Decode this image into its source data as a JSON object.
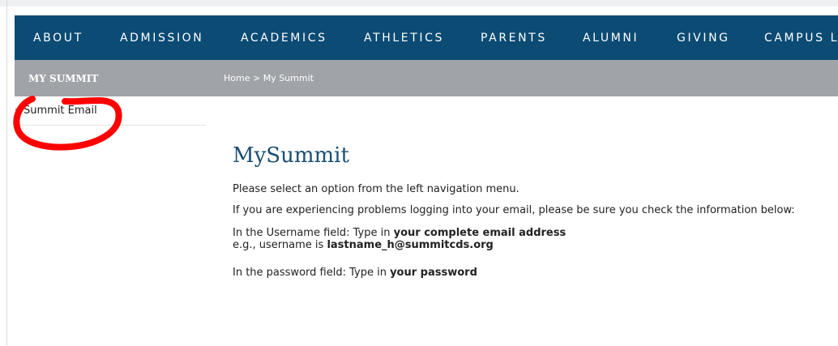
{
  "nav": {
    "items": [
      "ABOUT",
      "ADMISSION",
      "ACADEMICS",
      "ATHLETICS",
      "PARENTS",
      "ALUMNI",
      "GIVING",
      "CAMPUS L"
    ]
  },
  "subbar": {
    "title": "MY SUMMIT",
    "breadcrumb": {
      "home": "Home",
      "separator": ">",
      "current": "My Summit"
    }
  },
  "sidebar": {
    "items": [
      {
        "label": "Summit Email"
      }
    ]
  },
  "main": {
    "title": "MySummit",
    "intro": "Please select an option from the left navigation menu.",
    "help": "If you are experiencing problems logging into your email, please be sure you check the information below:",
    "username_prefix": "In the Username field: Type in ",
    "username_bold": "your complete email address",
    "example_prefix": "e.g., username is ",
    "example_bold": "lastname_h@summitcds.org",
    "password_prefix": "In the password field: Type in ",
    "password_bold": "your password"
  },
  "colors": {
    "nav_bg": "#0b4b74",
    "subbar_bg": "#a0a3a8",
    "title": "#1a4f75",
    "annotation": "#ff0000"
  }
}
